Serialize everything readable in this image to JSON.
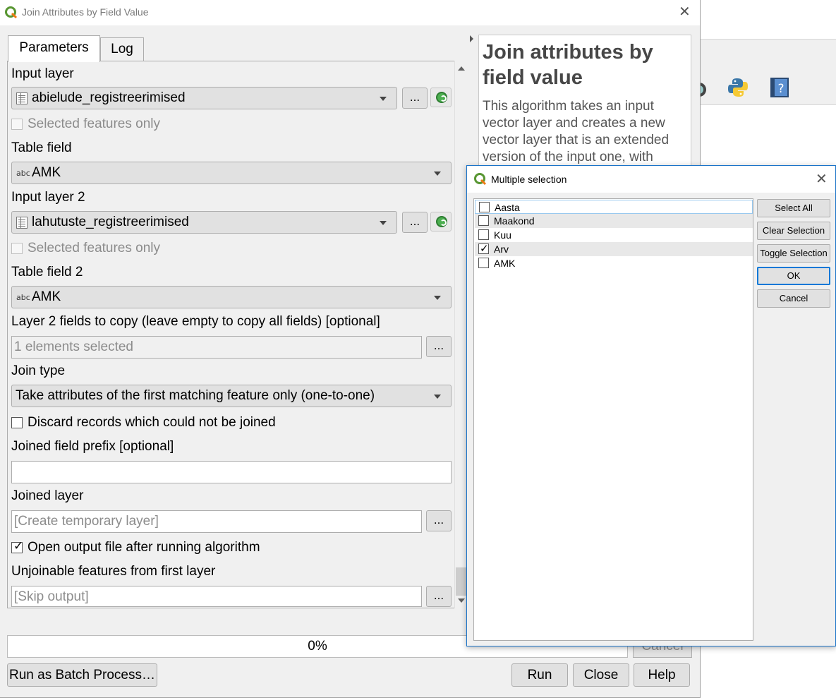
{
  "main_dialog": {
    "title": "Join Attributes by Field Value",
    "tabs": [
      "Parameters",
      "Log"
    ],
    "params": {
      "input_layer_label": "Input layer",
      "input_layer_value": "abielude_registreerimised",
      "selected_only_label": "Selected features only",
      "table_field_label": "Table field",
      "table_field_value": "AMK",
      "input_layer2_label": "Input layer 2",
      "input_layer2_value": "lahutuste_registreerimised",
      "selected_only2_label": "Selected features only",
      "table_field2_label": "Table field 2",
      "table_field2_value": "AMK",
      "fields_to_copy_label": "Layer 2 fields to copy (leave empty to copy all fields) [optional]",
      "fields_to_copy_value": "1 elements selected",
      "join_type_label": "Join type",
      "join_type_value": "Take attributes of the first matching feature only (one-to-one)",
      "discard_label": "Discard records which could not be joined",
      "prefix_label": "Joined field prefix [optional]",
      "prefix_value": "",
      "joined_layer_label": "Joined layer",
      "joined_layer_placeholder": "[Create temporary layer]",
      "open_output_label": "Open output file after running algorithm",
      "unjoinable_label": "Unjoinable features from first layer",
      "unjoinable_placeholder": "[Skip output]",
      "dots": "...",
      "abc": "abc"
    },
    "help": {
      "title": "Join attributes by field value",
      "description": "This algorithm takes an input vector layer and creates a new vector layer that is an extended version of the input one, with"
    },
    "progress_text": "0%",
    "buttons": {
      "cancel": "Cancel",
      "batch": "Run as Batch Process…",
      "run": "Run",
      "close": "Close",
      "help": "Help"
    }
  },
  "multi_select": {
    "title": "Multiple selection",
    "items": [
      {
        "label": "Aasta",
        "checked": false
      },
      {
        "label": "Maakond",
        "checked": false
      },
      {
        "label": "Kuu",
        "checked": false
      },
      {
        "label": "Arv",
        "checked": true
      },
      {
        "label": "AMK",
        "checked": false
      }
    ],
    "buttons": {
      "select_all": "Select All",
      "clear_selection": "Clear Selection",
      "toggle_selection": "Toggle Selection",
      "ok": "OK",
      "cancel": "Cancel"
    }
  },
  "icons": {
    "close": "close-icon",
    "qgis": "qgis-logo-icon",
    "python": "python-icon",
    "help_book": "help-book-icon"
  },
  "colors": {
    "accent_border": "#1a73c8",
    "qgis_green": "#589632",
    "window_bg": "#f0f0f0"
  }
}
